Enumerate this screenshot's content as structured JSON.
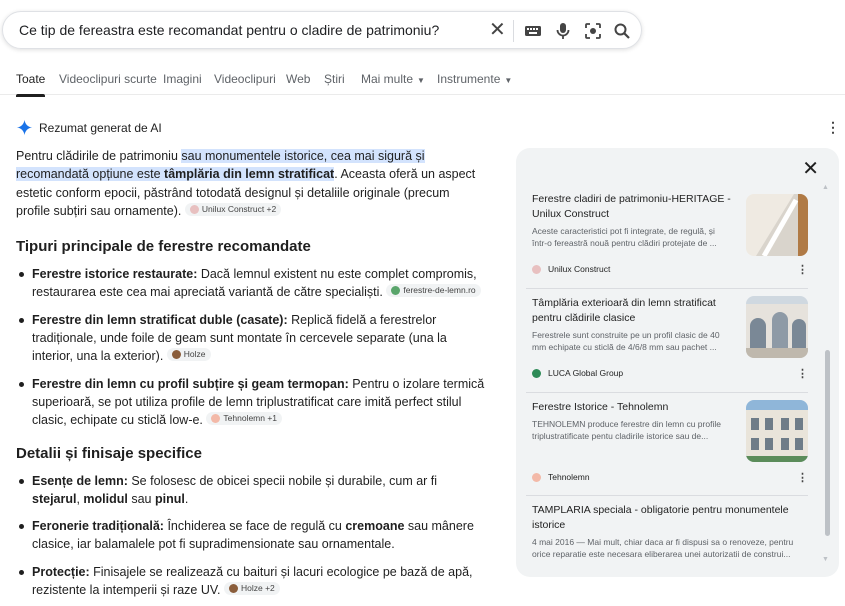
{
  "search": {
    "query": "Ce tip de fereastra este recomandat pentru o cladire de patrimoniu?"
  },
  "tabs": [
    {
      "label": "Toate"
    },
    {
      "label": "Videoclipuri scurte"
    },
    {
      "label": "Imagini"
    },
    {
      "label": "Videoclipuri"
    },
    {
      "label": "Web"
    },
    {
      "label": "Știri"
    },
    {
      "label": "Mai multe"
    },
    {
      "label": "Instrumente"
    }
  ],
  "ai": {
    "header": "Rezumat generat de AI",
    "intro_a": "Pentru clădirile de patrimoniu ",
    "intro_hl1": "sau monumentele istorice, cea mai sigură și recomandată opțiune este ",
    "intro_hl2": "tâmplăria din lemn stratificat",
    "intro_b": ". Aceasta oferă un aspect estetic conform epocii, păstrând totodată designul și detaliile originale (precum profile subțiri sau ornamente).",
    "intro_chip": "Unilux Construct +2",
    "h1": "Tipuri principale de ferestre recomandate",
    "items1": [
      {
        "bold": "Ferestre istorice restaurate:",
        "text": " Dacă lemnul existent nu este complet compromis, restaurarea este cea mai apreciată variantă de către specialiști.",
        "chip": "ferestre-de-lemn.ro"
      },
      {
        "bold": "Ferestre din lemn stratificat duble (casate):",
        "text": " Replică fidelă a ferestrelor tradiționale, unde foile de geam sunt montate în cercevele separate (una la interior, una la exterior).",
        "chip": "Holze"
      },
      {
        "bold": "Ferestre din lemn cu profil subțire și geam termopan:",
        "text": " Pentru o izolare termică superioară, se pot utiliza profile de lemn triplustratificat care imită perfect stilul clasic, echipate cu sticlă low-e.",
        "chip": "Tehnolemn +1"
      }
    ],
    "h2": "Detalii și finisaje specifice",
    "items2": [
      {
        "bold": "Esențe de lemn:",
        "t1": " Se folosesc de obicei specii nobile și durabile, cum ar fi ",
        "b1": "stejarul",
        "t2": ", ",
        "b2": "molidul",
        "t3": " sau ",
        "b3": "pinul",
        "t4": "."
      },
      {
        "bold": "Feronerie tradițională:",
        "t1": " Închiderea se face de regulă cu ",
        "b1": "cremoane",
        "t2": " sau mânere clasice, iar balamalele pot fi supradimensionate sau ornamentale."
      },
      {
        "bold": "Protecție:",
        "t1": " Finisajele se realizează cu baituri și lacuri ecologice pe bază de apă, rezistente la intemperii și raze UV.",
        "chip": "Holze +2"
      }
    ]
  },
  "panel": {
    "cards": [
      {
        "title": "Ferestre cladiri de patrimoniu-HERITAGE - Unilux Construct",
        "snippet": "Aceste caracteristici pot fi integrate, de regulă, și într-o fereastră nouă pentru clădiri protejate de ...",
        "source": "Unilux Construct"
      },
      {
        "title": "Tâmplăria exterioară din lemn stratificat pentru clădirile clasice",
        "snippet": "Ferestrele sunt construite pe un profil clasic de 40 mm echipate cu sticlă de 4/6/8 mm sau pachet ...",
        "source": "LUCA Global Group"
      },
      {
        "title": "Ferestre Istorice - Tehnolemn",
        "snippet": "TEHNOLEMN produce ferestre din lemn cu profile triplustratificate pentu cladirile istorice sau de...",
        "source": "Tehnolemn"
      },
      {
        "title": "TAMPLARIA speciala - obligatorie pentru monumentele istorice",
        "snippet": "4 mai 2016 — Mai mult, chiar daca ar fi dispusi sa o renoveze, pentru orice reparatie este necesara eliberarea unei autorizatii de construi..."
      }
    ]
  },
  "colors": {
    "accent": "#1a73e8",
    "highlight": "#d3e3fd",
    "panel_bg": "#f1f3f4"
  }
}
